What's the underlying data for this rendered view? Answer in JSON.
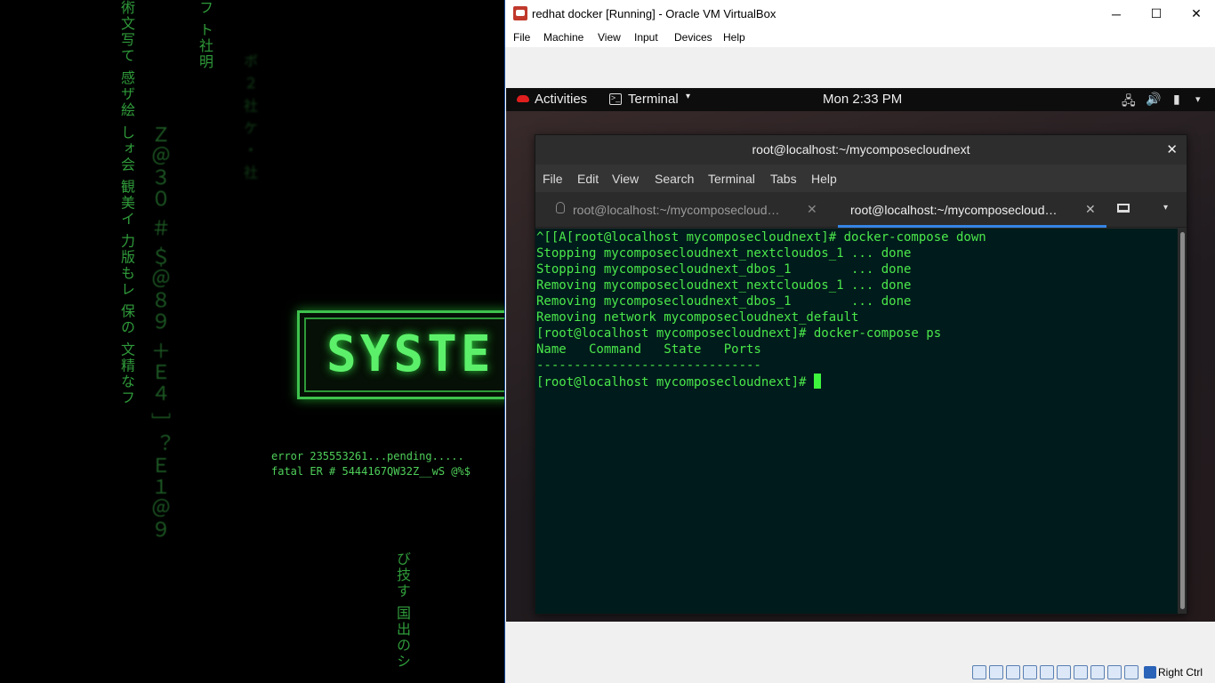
{
  "wallpaper": {
    "banner_text": "SYSTE",
    "error_lines": [
      "error 235553261...pending.....",
      "fatal ER # 5444167QW32Z__wS @%$"
    ],
    "kana_columns": [
      "術文写て 感ザ絵 しォ会 観美イ 力版もレ 保の 文精なフ",
      "フ ト社明",
      "び技す 国出のシ"
    ]
  },
  "vbox": {
    "title": "redhat docker  [Running] - Oracle VM VirtualBox",
    "window_controls": {
      "minimize": "─",
      "maximize": "☐",
      "close": "✕"
    },
    "menu": [
      "File",
      "Machine",
      "View",
      "Input",
      "Devices",
      "Help"
    ],
    "host_key": "Right Ctrl"
  },
  "gnome": {
    "activities": "Activities",
    "app_name": "Terminal",
    "app_caret": "▾",
    "clock": "Mon  2:33 PM",
    "tray_icons": [
      "network-icon",
      "volume-icon",
      "battery-icon",
      "system-menu-caret-icon"
    ],
    "tray_glyphs": {
      "network": "🖧",
      "volume": "🔊",
      "battery": "▮",
      "caret": "▾"
    }
  },
  "terminal": {
    "title": "root@localhost:~/mycomposecloudnext",
    "close_glyph": "✕",
    "menu": [
      "File",
      "Edit",
      "View",
      "Search",
      "Terminal",
      "Tabs",
      "Help"
    ],
    "tabs": [
      {
        "label": "root@localhost:~/mycomposecloud…",
        "active": false,
        "close": "✕"
      },
      {
        "label": "root@localhost:~/mycomposecloud…",
        "active": true,
        "close": "✕"
      }
    ],
    "tabs_menu_caret": "▾",
    "lines": [
      "^[[A[root@localhost mycomposecloudnext]# docker-compose down",
      "Stopping mycomposecloudnext_nextcloudos_1 ... done",
      "Stopping mycomposecloudnext_dbos_1        ... done",
      "Removing mycomposecloudnext_nextcloudos_1 ... done",
      "Removing mycomposecloudnext_dbos_1        ... done",
      "Removing network mycomposecloudnext_default",
      "[root@localhost mycomposecloudnext]# docker-compose ps",
      "Name   Command   State   Ports",
      "------------------------------",
      "[root@localhost mycomposecloudnext]# "
    ]
  },
  "colors": {
    "terminal_bg": "#001b1b",
    "terminal_fg": "#4be84b",
    "tab_accent": "#3584e4",
    "matrix_green": "#5cf06a"
  }
}
